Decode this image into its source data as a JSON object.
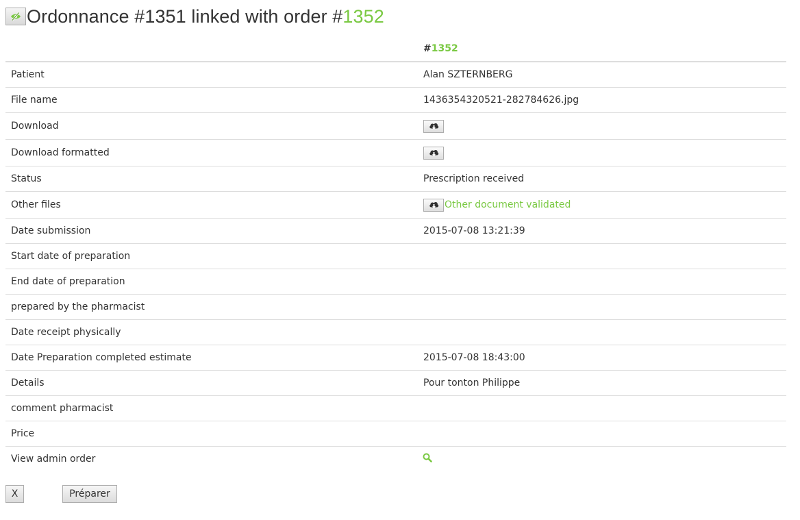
{
  "header": {
    "title_prefix": "Ordonnance #1351 linked with order #",
    "order_number": "1352",
    "toggle_icon": "eye-slash-icon"
  },
  "table": {
    "column_header_hash": "#",
    "column_header_order": "1352",
    "rows": {
      "patient": {
        "label": "Patient",
        "value": "Alan SZTERNBERG"
      },
      "file_name": {
        "label": "File name",
        "value": "1436354320521-282784626.jpg"
      },
      "download": {
        "label": "Download",
        "icon": "cloud-download-icon"
      },
      "download_formatted": {
        "label": "Download formatted",
        "icon": "cloud-download-icon"
      },
      "status": {
        "label": "Status",
        "value": "Prescription received"
      },
      "other_files": {
        "label": "Other files",
        "icon": "cloud-download-icon",
        "link_text": "Other document validated"
      },
      "date_submission": {
        "label": "Date submission",
        "value": "2015-07-08 13:21:39"
      },
      "start_date_preparation": {
        "label": "Start date of preparation",
        "value": ""
      },
      "end_date_preparation": {
        "label": "End date of preparation",
        "value": ""
      },
      "prepared_by": {
        "label": "prepared by the pharmacist",
        "value": ""
      },
      "date_receipt": {
        "label": "Date receipt physically",
        "value": ""
      },
      "date_completed_estimate": {
        "label": "Date Preparation completed estimate",
        "value": "2015-07-08 18:43:00"
      },
      "details": {
        "label": "Details",
        "value": "Pour tonton Philippe"
      },
      "comment_pharmacist": {
        "label": "comment pharmacist",
        "value": ""
      },
      "price": {
        "label": "Price",
        "value": ""
      },
      "view_admin_order": {
        "label": "View admin order",
        "icon": "search-icon"
      }
    }
  },
  "buttons": {
    "close_label": "X",
    "prepare_label": "Préparer"
  },
  "colors": {
    "accent": "#7ac943",
    "text": "#333333",
    "border": "#dddddd"
  }
}
